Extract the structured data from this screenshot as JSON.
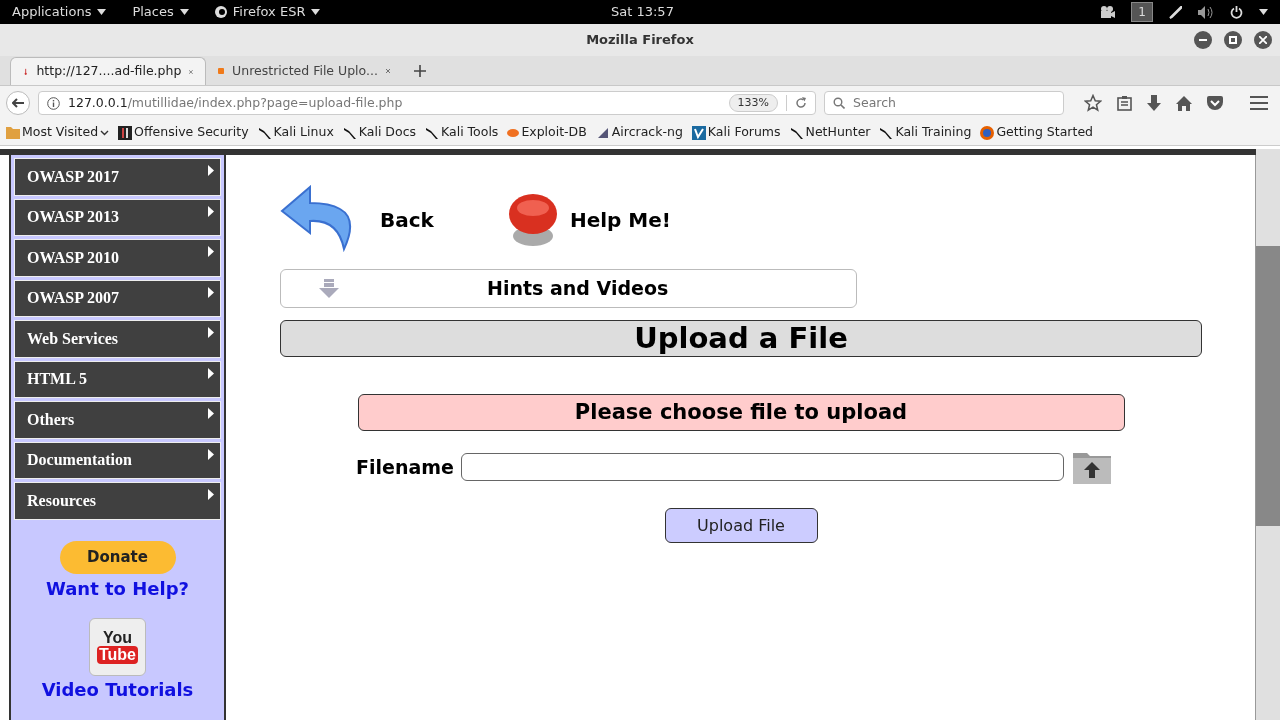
{
  "top_bar": {
    "menus": [
      "Applications",
      "Places",
      "Firefox ESR"
    ],
    "clock": "Sat 13:57",
    "workspace": "1"
  },
  "window": {
    "title": "Mozilla Firefox"
  },
  "tabs": [
    {
      "label": "http://127....ad-file.php",
      "selected": true
    },
    {
      "label": "Unrestricted File Uplo...",
      "selected": false
    }
  ],
  "address_bar": {
    "host": "127.0.0.1",
    "path": "/mutillidae/index.php?page=upload-file.php",
    "zoom": "133%"
  },
  "search": {
    "placeholder": "Search"
  },
  "bookmarks": [
    {
      "label": "Most Visited",
      "kind": "folder"
    },
    {
      "label": "Offensive Security",
      "kind": "offsec"
    },
    {
      "label": "Kali Linux",
      "kind": "kali"
    },
    {
      "label": "Kali Docs",
      "kind": "kali"
    },
    {
      "label": "Kali Tools",
      "kind": "kali"
    },
    {
      "label": "Exploit-DB",
      "kind": "exploit"
    },
    {
      "label": "Aircrack-ng",
      "kind": "aircrack"
    },
    {
      "label": "Kali Forums",
      "kind": "forums"
    },
    {
      "label": "NetHunter",
      "kind": "kali"
    },
    {
      "label": "Kali Training",
      "kind": "kali"
    },
    {
      "label": "Getting Started",
      "kind": "firefox"
    }
  ],
  "sidebar": {
    "items": [
      "OWASP 2017",
      "OWASP 2013",
      "OWASP 2010",
      "OWASP 2007",
      "Web Services",
      "HTML 5",
      "Others",
      "Documentation",
      "Resources"
    ],
    "donate": "Donate",
    "want_help": "Want to Help?",
    "youtube": [
      "You",
      "Tube"
    ],
    "video_tutorials": "Video Tutorials"
  },
  "content": {
    "back": "Back",
    "help": "Help Me!",
    "hints": "Hints and Videos",
    "heading": "Upload a File",
    "message": "Please choose file to upload",
    "filename_label": "Filename",
    "upload_button": "Upload File"
  }
}
